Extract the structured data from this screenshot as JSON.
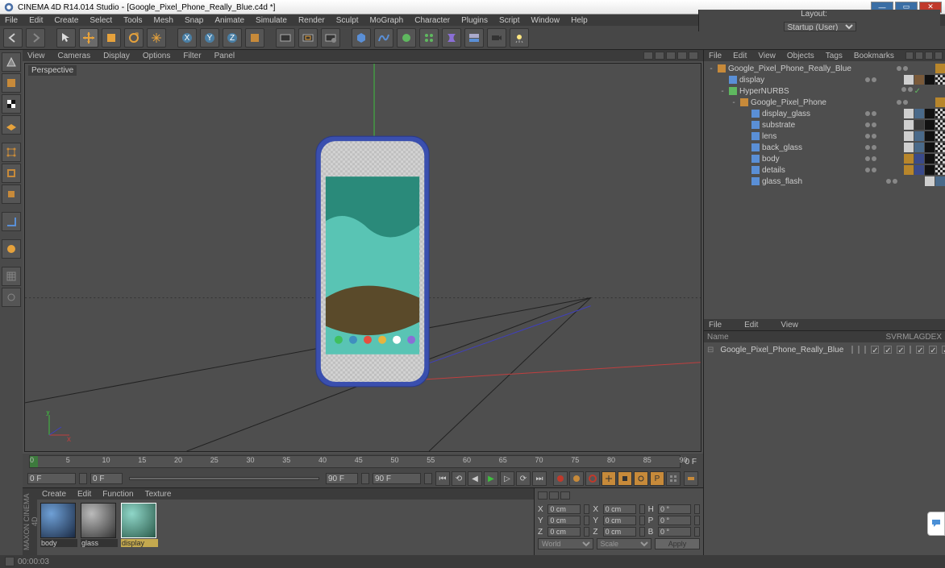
{
  "titlebar": {
    "app": "CINEMA 4D R14.014 Studio",
    "doc": "[Google_Pixel_Phone_Really_Blue.c4d *]"
  },
  "menubar": [
    "File",
    "Edit",
    "Create",
    "Select",
    "Tools",
    "Mesh",
    "Snap",
    "Animate",
    "Simulate",
    "Render",
    "Sculpt",
    "MoGraph",
    "Character",
    "Plugins",
    "Script",
    "Window",
    "Help"
  ],
  "layout_label": "Layout:",
  "layout_value": "Startup (User)",
  "viewmenu": [
    "View",
    "Cameras",
    "Display",
    "Options",
    "Filter",
    "Panel"
  ],
  "viewport_label": "Perspective",
  "obj_panel_menu": [
    "File",
    "Edit",
    "View",
    "Objects",
    "Tags",
    "Bookmarks"
  ],
  "tree": [
    {
      "depth": 0,
      "toggle": "-",
      "icon": "#c78a3a",
      "name": "Google_Pixel_Phone_Really_Blue",
      "mats": [
        "#b8862b"
      ]
    },
    {
      "depth": 1,
      "toggle": "",
      "icon": "#5a8fd6",
      "name": "display",
      "mats": [
        "#cfcfcf",
        "#7a5a3a",
        "#111"
      ],
      "extra": true
    },
    {
      "depth": 1,
      "toggle": "-",
      "icon": "#5fb85f",
      "name": "HyperNURBS",
      "mats": [],
      "check": true
    },
    {
      "depth": 2,
      "toggle": "-",
      "icon": "#c78a3a",
      "name": "Google_Pixel_Phone",
      "mats": [
        "#b8862b"
      ]
    },
    {
      "depth": 3,
      "toggle": "",
      "icon": "#5a8fd6",
      "name": "display_glass",
      "mats": [
        "#cfcfcf",
        "#4a6a8a",
        "#111"
      ],
      "extra": true
    },
    {
      "depth": 3,
      "toggle": "",
      "icon": "#5a8fd6",
      "name": "substrate",
      "mats": [
        "#cfcfcf",
        "#3a3a3a",
        "#111"
      ],
      "extra": true
    },
    {
      "depth": 3,
      "toggle": "",
      "icon": "#5a8fd6",
      "name": "lens",
      "mats": [
        "#cfcfcf",
        "#4a6a8a",
        "#111"
      ],
      "extra": true
    },
    {
      "depth": 3,
      "toggle": "",
      "icon": "#5a8fd6",
      "name": "back_glass",
      "mats": [
        "#cfcfcf",
        "#4a6a8a",
        "#111"
      ],
      "extra": true
    },
    {
      "depth": 3,
      "toggle": "",
      "icon": "#5a8fd6",
      "name": "body",
      "mats": [
        "#b8862b",
        "#3a4a8a",
        "#111"
      ],
      "extra": true
    },
    {
      "depth": 3,
      "toggle": "",
      "icon": "#5a8fd6",
      "name": "details",
      "mats": [
        "#b8862b",
        "#3a4a8a",
        "#111"
      ],
      "extra": true
    },
    {
      "depth": 3,
      "toggle": "",
      "icon": "#5a8fd6",
      "name": "glass_flash",
      "mats": [
        "#cfcfcf",
        "#4a6a8a"
      ]
    }
  ],
  "attr_panel_menu": [
    "File",
    "Edit",
    "View"
  ],
  "attr_header_name": "Name",
  "attr_header_cols": [
    "S",
    "V",
    "R",
    "M",
    "L",
    "A",
    "G",
    "D",
    "E",
    "X"
  ],
  "attr_item": "Google_Pixel_Phone_Really_Blue",
  "timeline": {
    "start": 0,
    "end": 90,
    "step": 5,
    "playhead": 0,
    "label_right": "0 F"
  },
  "timerow": {
    "left": "0 F",
    "slider_left": "0 F",
    "slider_right": "90 F",
    "right": "90 F"
  },
  "mat_menu": [
    "Create",
    "Edit",
    "Function",
    "Texture"
  ],
  "materials": [
    {
      "name": "body",
      "sel": false,
      "grad": "radial-gradient(circle at 30% 30%, #6fa0d6, #1a2a44)"
    },
    {
      "name": "glass",
      "sel": false,
      "grad": "radial-gradient(circle at 30% 30%, #bbb, #333)"
    },
    {
      "name": "display",
      "sel": true,
      "grad": "radial-gradient(circle at 30% 30%, #8fd6c8, #2a5a4a)"
    }
  ],
  "coords": {
    "rows": [
      {
        "a": "X",
        "av": "0 cm",
        "b": "X",
        "bv": "0 cm",
        "c": "H",
        "cv": "0 °"
      },
      {
        "a": "Y",
        "av": "0 cm",
        "b": "Y",
        "bv": "0 cm",
        "c": "P",
        "cv": "0 °"
      },
      {
        "a": "Z",
        "av": "0 cm",
        "b": "Z",
        "bv": "0 cm",
        "c": "B",
        "cv": "0 °"
      }
    ],
    "mode1": "World",
    "mode2": "Scale",
    "apply": "Apply"
  },
  "status_time": "00:00:03"
}
